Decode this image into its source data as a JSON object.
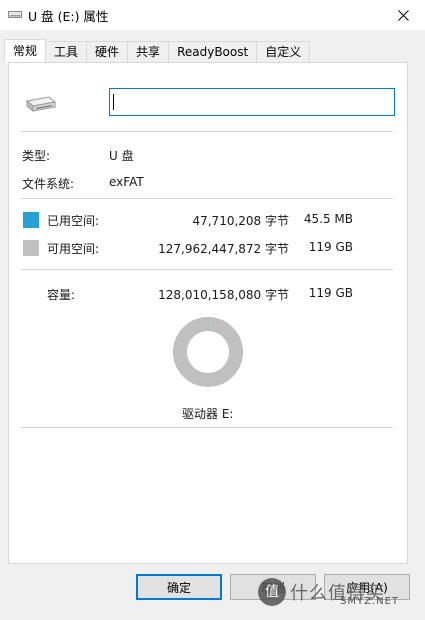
{
  "window": {
    "title": "U 盘 (E:) 属性",
    "close_icon": "close-icon"
  },
  "tabs": [
    {
      "label": "常规",
      "active": true
    },
    {
      "label": "工具",
      "active": false
    },
    {
      "label": "硬件",
      "active": false
    },
    {
      "label": "共享",
      "active": false
    },
    {
      "label": "ReadyBoost",
      "active": false
    },
    {
      "label": "自定义",
      "active": false
    }
  ],
  "general": {
    "drive_icon": "usb-drive-icon",
    "name_value": "",
    "type_label": "类型:",
    "type_value": "U 盘",
    "fs_label": "文件系统:",
    "fs_value": "exFAT"
  },
  "space": {
    "used": {
      "label": "已用空间:",
      "bytes": "47,710,208 字节",
      "size": "45.5 MB",
      "color": "#26a0da",
      "fraction": 0.000373
    },
    "free": {
      "label": "可用空间:",
      "bytes": "127,962,447,872 字节",
      "size": "119 GB",
      "color": "#c0c0c0"
    },
    "capacity": {
      "label": "容量:",
      "bytes": "128,010,158,080 字节",
      "size": "119 GB"
    }
  },
  "drive_label": "驱动器 E:",
  "buttons": {
    "ok": "确定",
    "cancel": "取消",
    "apply": "应用(A)"
  },
  "watermark": {
    "circle": "值",
    "text": "什么值得买",
    "sub": "SMYZ.NET"
  }
}
